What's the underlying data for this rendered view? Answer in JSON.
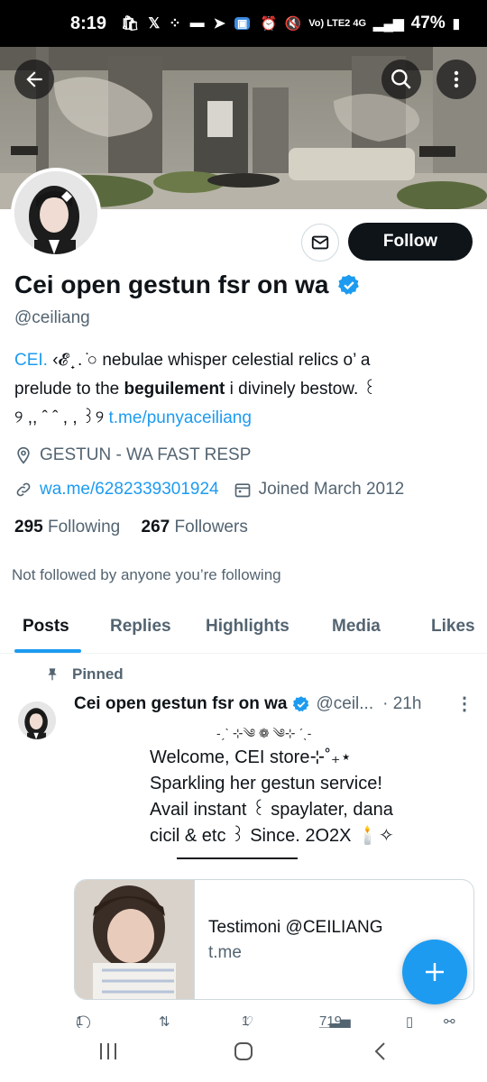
{
  "status_bar": {
    "time": "8:19",
    "icons_left": [
      "shopee-icon",
      "x-icon",
      "grid-icon",
      "folder-icon",
      "telegram-icon",
      "app-icon"
    ],
    "network": "Vo) LTE2 4G",
    "battery": "47%"
  },
  "profile": {
    "name": "Cei open gestun fsr on wa",
    "verified": true,
    "handle": "@ceiliang",
    "follow_label": "Follow",
    "bio": {
      "line1_link": "CEI.",
      "line1_rest": " ‹𝓔 ̟ . ̇○ nebulae whisper celestial relics o’ a",
      "line2_pre": "prelude to the ",
      "line2_bold": "beguilement",
      "line2_post": " i divinely bestow. ꒰",
      "line3_pre": "୨ ,, ˆ ˆ , , ꒱୨ ",
      "line3_link": "t.me/punyaceiliang"
    },
    "location": "GESTUN - WA FAST RESP",
    "website": "wa.me/6282339301924",
    "joined": "Joined March 2012",
    "following_count": "295",
    "following_label": "Following",
    "followers_count": "267",
    "followers_label": "Followers",
    "not_followed": "Not followed by anyone you’re following"
  },
  "tabs": [
    "Posts",
    "Replies",
    "Highlights",
    "Media",
    "Likes"
  ],
  "pinned_tweet": {
    "pinned_label": "Pinned",
    "author": "Cei open gestun fsr on wa",
    "handle_trunc": "@ceil...",
    "time": "· 21h",
    "deco": "-ˏˋ ⊹༄ ❁ ༄⊹ ˊˎ-",
    "text": "Welcome, CEI store⊹˚₊⋆\nSparkling her gestun service!\nAvail instant ꒰ spaylater, dana\ncicil & etc ꒱ Since. 2O2X 🕯️✧",
    "card_title": "Testimoni @CEILIANG",
    "card_domain": "t.me",
    "reply_count": "1",
    "like_count": "1",
    "views_count": "719"
  },
  "colors": {
    "accent": "#1d9bf0",
    "text": "#0f1419",
    "secondary": "#536471",
    "border": "#cfd9de"
  }
}
